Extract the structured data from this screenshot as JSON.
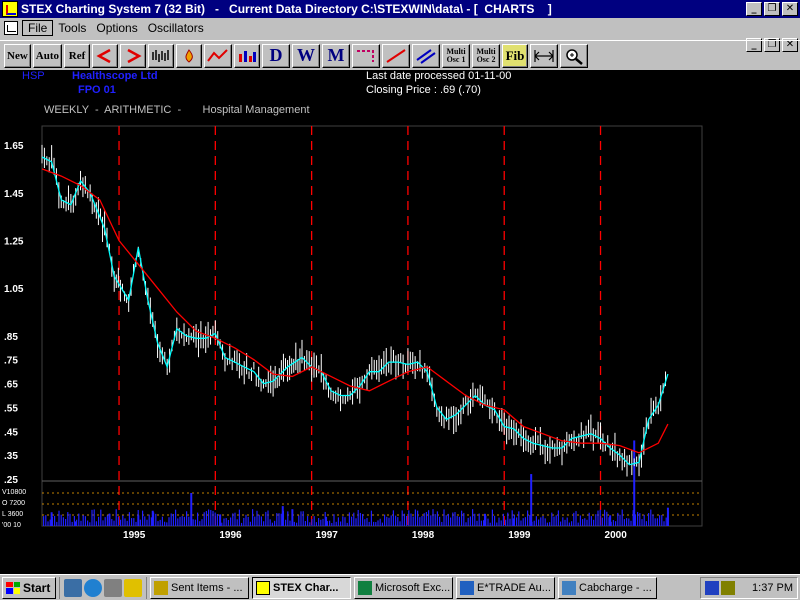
{
  "window": {
    "title": "STEX Charting System 7 (32 Bit)   -   Current Data Directory C:\\STEXWIN\\data\\ - [  CHARTS    ]"
  },
  "menu": [
    "File",
    "Tools",
    "Options",
    "Oscillators"
  ],
  "toolbar": {
    "new": "New",
    "auto": "Auto",
    "ref": "Ref",
    "d": "D",
    "w": "W",
    "m": "M",
    "multi1_a": "Multi",
    "multi1_b": "Osc 1",
    "multi2_a": "Multi",
    "multi2_b": "Osc 2",
    "fib": "Fib"
  },
  "stock": {
    "code": "HSP",
    "name": "Healthscope Ltd",
    "type": "FPO 01",
    "last_date": "Last date processed 01-11-00",
    "closing": "Closing Price : .69  (.70)",
    "mode": "WEEKLY  -  ARITHMETIC  -       Hospital Management"
  },
  "colors": {
    "price_up": "#ffffff",
    "price_down": "#ffffff",
    "ma_fast": "#00ffff",
    "ma_slow": "#ff0000",
    "volume": "#2020ff",
    "year_divider": "#ff0000",
    "axis_text": "#ffffff",
    "header_blue": "#0000ff",
    "header_white": "#ffffff",
    "header_gray": "#c0c0c0"
  },
  "chart_data": {
    "type": "line",
    "title": "",
    "xlabel": "",
    "ylabel": "",
    "ylim": [
      0.25,
      1.73
    ],
    "yticks": [
      "1.65",
      "1.45",
      "1.25",
      "1.05",
      ".85",
      ".75",
      ".65",
      ".55",
      ".45",
      ".35",
      ".25"
    ],
    "ytick_values": [
      1.65,
      1.45,
      1.25,
      1.05,
      0.85,
      0.75,
      0.65,
      0.55,
      0.45,
      0.35,
      0.25
    ],
    "xticks": [
      "1995",
      "1996",
      "1997",
      "1998",
      "1999",
      "2000"
    ],
    "xtick_values": [
      1995,
      1996,
      1997,
      1998,
      1999,
      2000
    ],
    "volume_ticks": [
      "V10800",
      "O  7200",
      "L  3600",
      "'00   10"
    ],
    "x_range": [
      1994.2,
      2000.95
    ],
    "series": [
      {
        "name": "",
        "x": [
          1994.2,
          1994.3,
          1994.4,
          1994.5,
          1994.6,
          1994.7,
          1994.85,
          1994.95,
          1995.1,
          1995.2,
          1995.3,
          1995.4,
          1995.5,
          1995.6,
          1995.7,
          1995.8,
          1995.9,
          1996.0,
          1996.1,
          1996.2,
          1996.3,
          1996.4,
          1996.5,
          1996.6,
          1996.75,
          1996.9,
          1997.0,
          1997.1,
          1997.2,
          1997.3,
          1997.4,
          1997.5,
          1997.6,
          1997.7,
          1997.8,
          1997.9,
          1998.0,
          1998.1,
          1998.2,
          1998.3,
          1998.4,
          1998.5,
          1998.6,
          1998.7,
          1998.8,
          1998.9,
          1999.0,
          1999.1,
          1999.2,
          1999.3,
          1999.4,
          1999.5,
          1999.6,
          1999.7,
          1999.8,
          1999.9,
          2000.0,
          2000.1,
          2000.2,
          2000.3,
          2000.4,
          2000.5,
          2000.6,
          2000.7
        ],
        "values": [
          1.6,
          1.58,
          1.42,
          1.4,
          1.5,
          1.45,
          1.3,
          1.1,
          1.0,
          1.22,
          1.0,
          0.82,
          0.72,
          0.88,
          0.85,
          0.84,
          0.84,
          0.86,
          0.76,
          0.74,
          0.72,
          0.7,
          0.65,
          0.66,
          0.72,
          0.76,
          0.72,
          0.7,
          0.62,
          0.6,
          0.6,
          0.64,
          0.7,
          0.7,
          0.74,
          0.74,
          0.73,
          0.74,
          0.7,
          0.55,
          0.5,
          0.52,
          0.56,
          0.6,
          0.56,
          0.54,
          0.47,
          0.46,
          0.42,
          0.4,
          0.39,
          0.38,
          0.38,
          0.42,
          0.43,
          0.44,
          0.42,
          0.38,
          0.35,
          0.31,
          0.32,
          0.5,
          0.56,
          0.69
        ]
      },
      {
        "name": "",
        "x": [
          1994.2,
          1994.4,
          1994.6,
          1994.8,
          1995.0,
          1995.2,
          1995.4,
          1995.6,
          1995.8,
          1996.0,
          1996.2,
          1996.4,
          1996.6,
          1996.8,
          1997.0,
          1997.2,
          1997.4,
          1997.6,
          1997.8,
          1998.0,
          1998.2,
          1998.4,
          1998.6,
          1998.8,
          1999.0,
          1999.2,
          1999.4,
          1999.6,
          1999.8,
          2000.0,
          2000.2,
          2000.4,
          2000.6,
          2000.7
        ],
        "values": [
          1.55,
          1.52,
          1.48,
          1.42,
          1.25,
          1.15,
          1.05,
          0.95,
          0.87,
          0.84,
          0.8,
          0.75,
          0.69,
          0.68,
          0.72,
          0.68,
          0.64,
          0.62,
          0.66,
          0.7,
          0.72,
          0.66,
          0.6,
          0.56,
          0.54,
          0.47,
          0.44,
          0.41,
          0.4,
          0.4,
          0.39,
          0.36,
          0.4,
          0.48
        ]
      }
    ],
    "volume": {
      "x": [
        1994.3,
        1994.55,
        1994.9,
        1995.2,
        1995.35,
        1995.75,
        1996.05,
        1996.7,
        1996.8,
        1997.15,
        1998.8,
        1999.1,
        1999.28,
        2000.1,
        2000.35,
        2000.7
      ],
      "values": [
        4500,
        1500,
        4000,
        3500,
        5000,
        10800,
        3800,
        6500,
        5500,
        3000,
        4000,
        2500,
        17000,
        3500,
        28000,
        6000
      ]
    }
  },
  "taskbar": {
    "start": "Start",
    "tasks": [
      "Sent Items - ...",
      "STEX Char...",
      "Microsoft Exc...",
      "E*TRADE Au...",
      "Cabcharge - ..."
    ],
    "clock": "1:37 PM"
  }
}
